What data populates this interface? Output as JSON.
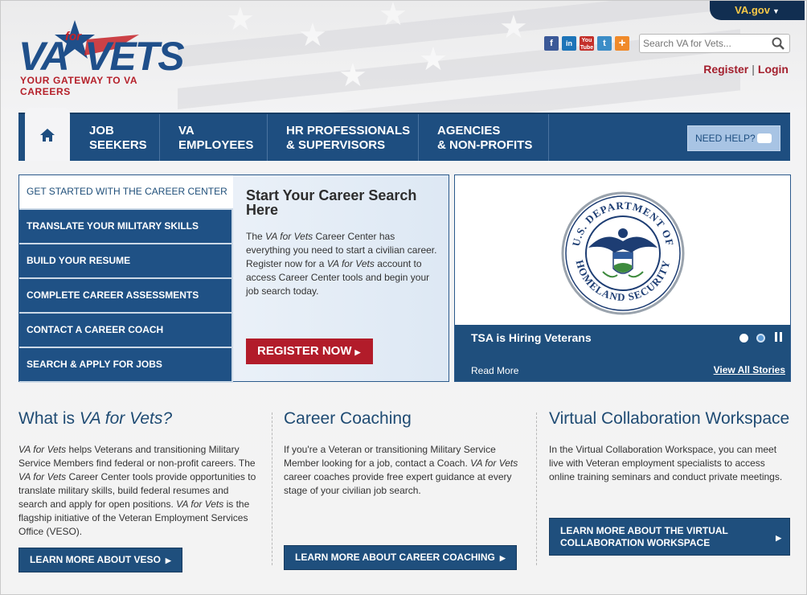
{
  "header": {
    "vagov_label": "VA.gov",
    "logo": {
      "va": "VA",
      "for": "for",
      "vets": "VETS",
      "tagline": "YOUR GATEWAY TO VA CAREERS"
    },
    "social": [
      "facebook-icon",
      "linkedin-icon",
      "youtube-icon",
      "twitter-icon",
      "addthis-icon"
    ],
    "search": {
      "placeholder": "Search VA for Vets..."
    },
    "register_label": "Register",
    "separator": "|",
    "login_label": "Login"
  },
  "nav": {
    "items": [
      {
        "line1": "JOB",
        "line2": "SEEKERS"
      },
      {
        "line1": "VA",
        "line2": "EMPLOYEES"
      },
      {
        "line1": "HR PROFESSIONALS",
        "line2": "& SUPERVISORS"
      },
      {
        "line1": "AGENCIES",
        "line2": "& NON-PROFITS"
      }
    ],
    "need_help_label": "NEED HELP?"
  },
  "career_menu": {
    "items": [
      "GET STARTED WITH THE CAREER CENTER",
      "TRANSLATE YOUR MILITARY SKILLS",
      "BUILD YOUR RESUME",
      "COMPLETE CAREER ASSESSMENTS",
      "CONTACT A CAREER COACH",
      "SEARCH & APPLY FOR JOBS"
    ],
    "content_title": "Start Your Career Search Here",
    "content_body": {
      "p1": "The ",
      "brand": "VA for Vets",
      "p2": " Career Center has everything you need to start a civilian career. Register now for a ",
      "brand2": "VA for Vets",
      "p3": " account to access Career Center tools and begin your job search today."
    },
    "register_button": "REGISTER NOW"
  },
  "carousel": {
    "seal_top_text": "U.S. DEPARTMENT OF",
    "seal_bottom_text": "HOMELAND SECURITY",
    "caption": "TSA is Hiring Veterans",
    "read_more": "Read More",
    "view_all": "View All Stories"
  },
  "columns": [
    {
      "title_plain": "What is ",
      "title_em": "VA for Vets?",
      "body_em1": "VA for Vets",
      "body_1": " helps Veterans and transitioning Military Service Members find federal or non-profit careers. The ",
      "body_em2": "VA for Vets",
      "body_2": " Career Center tools provide opportunities to translate military skills, build federal resumes and search and apply for open positions. ",
      "body_em3": "VA for Vets",
      "body_3": " is the flagship initiative of the Veteran Employment Services Office (VESO).",
      "button": "LEARN MORE ABOUT VESO"
    },
    {
      "title_plain": "Career Coaching",
      "body_1": "If you're a Veteran or transitioning Military Service Member looking for a job, contact a Coach. ",
      "body_em1": "VA for Vets",
      "body_2": " career coaches provide free expert guidance at every stage of your civilian job search.",
      "button": "LEARN MORE ABOUT CAREER COACHING"
    },
    {
      "title_plain": "Virtual Collaboration Workspace",
      "body_1": "In the Virtual Collaboration Workspace, you can meet live with Veteran employment specialists to access online training seminars and conduct private meetings.",
      "button_line1": "LEARN MORE ABOUT THE VIRTUAL",
      "button_line2": "COLLABORATION WORKSPACE"
    }
  ],
  "colors": {
    "navy": "#1e4e80",
    "red": "#b21c2a",
    "gold": "#f7c948"
  }
}
